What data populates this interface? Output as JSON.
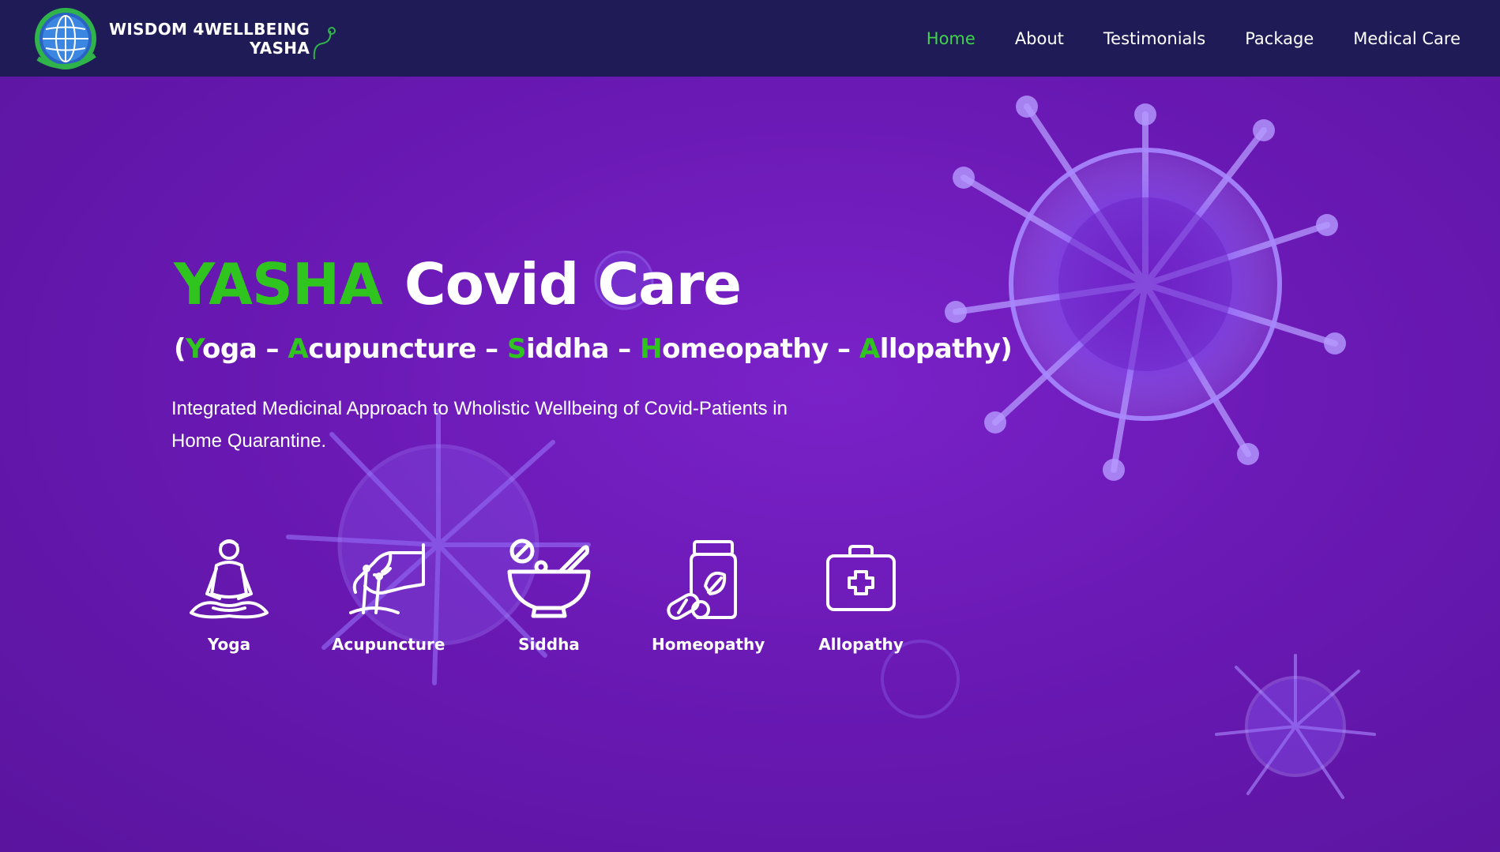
{
  "brand": {
    "line1": "WISDOM 4WELLBEING",
    "line2": "YASHA"
  },
  "nav": {
    "items": [
      {
        "label": "Home",
        "active": true
      },
      {
        "label": "About"
      },
      {
        "label": "Testimonials"
      },
      {
        "label": "Package"
      },
      {
        "label": "Medical Care"
      }
    ]
  },
  "hero": {
    "title_highlight": "YASHA",
    "title_rest": "Covid Care",
    "subtitle": {
      "open": "(",
      "parts": [
        {
          "initial": "Y",
          "rest": "oga"
        },
        {
          "initial": "A",
          "rest": "cupuncture"
        },
        {
          "initial": "S",
          "rest": "iddha"
        },
        {
          "initial": "H",
          "rest": "omeopathy"
        },
        {
          "initial": "A",
          "rest": "llopathy"
        }
      ],
      "separator": " – ",
      "close": ")"
    },
    "description": "Integrated Medicinal Approach to Wholistic Wellbeing of Covid-Patients in Home Quarantine."
  },
  "therapies": [
    {
      "label": "Yoga",
      "icon": "yoga-meditation-icon"
    },
    {
      "label": "Acupuncture",
      "icon": "acupuncture-hand-icon"
    },
    {
      "label": "Siddha",
      "icon": "mortar-pestle-icon"
    },
    {
      "label": "Homeopathy",
      "icon": "medicine-jar-icon"
    },
    {
      "label": "Allopathy",
      "icon": "first-aid-kit-icon"
    }
  ],
  "colors": {
    "navbar_bg": "#1f1b56",
    "hero_bg": "#6a19b4",
    "accent_green": "#2fc51e",
    "nav_active": "#3fd44a",
    "virus_tint": "#9a6bff"
  }
}
